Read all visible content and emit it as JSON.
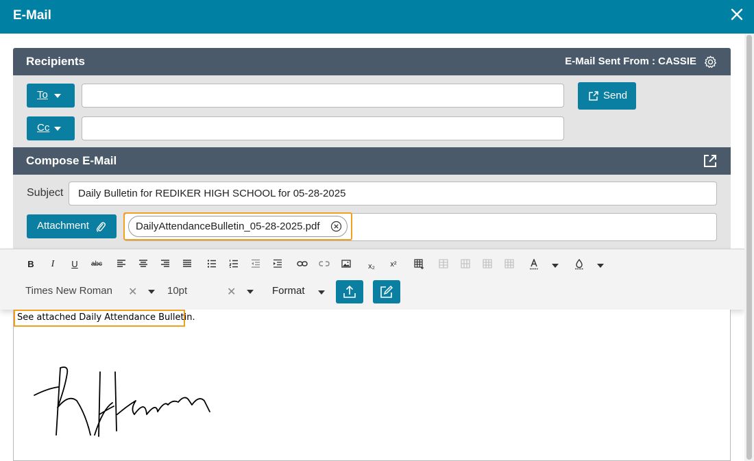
{
  "window": {
    "title": "E-Mail",
    "close_icon": "close-icon"
  },
  "recipients": {
    "header": "Recipients",
    "sent_from": "E-Mail Sent From : CASSIE",
    "settings_icon": "gear-icon",
    "to_label": "To",
    "cc_label": "Cc",
    "to_value": "",
    "cc_value": "",
    "send_label": "Send"
  },
  "compose": {
    "header": "Compose E-Mail",
    "popout_icon": "external-link-icon",
    "subject_label": "Subject",
    "subject_value": "Daily Bulletin for REDIKER HIGH SCHOOL for 05-28-2025",
    "attachment_label": "Attachment",
    "attachment_file": "DailyAttendanceBulletin_05-28-2025.pdf"
  },
  "toolbar": {
    "bold": "B",
    "italic": "I",
    "underline": "U",
    "strikethrough": "abc",
    "subscript": "x₂",
    "superscript": "x²",
    "font_family": "Times New Roman",
    "font_size": "10pt",
    "format_label": "Format",
    "clear_glyph": "✕"
  },
  "editor": {
    "body_text": "See attached Daily Attendance Bulletin."
  },
  "colors": {
    "titlebar": "#0080a3",
    "header": "#4a5a6a",
    "button": "#0b7fa1",
    "highlight": "#f0a020",
    "panel": "#e4e4e4"
  }
}
